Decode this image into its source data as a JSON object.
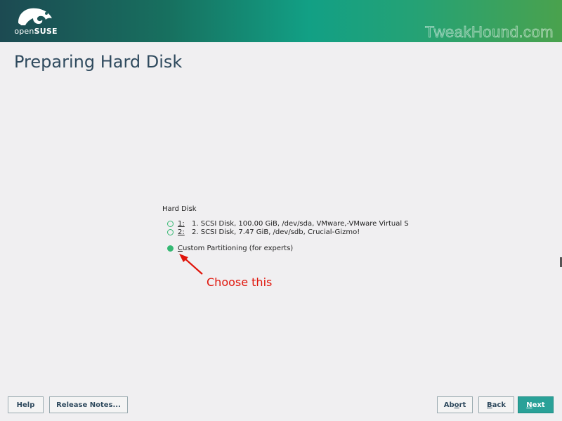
{
  "header": {
    "logo_text_light": "open",
    "logo_text_bold": "SUSE",
    "watermark": "TweakHound.com"
  },
  "page_title": "Preparing Hard Disk",
  "hard_disk": {
    "label": "Hard Disk",
    "options": [
      {
        "key": "1:",
        "text": "1. SCSI Disk, 100.00 GiB, /dev/sda, VMware,-VMware Virtual S",
        "selected": false
      },
      {
        "key": "2:",
        "text": "2. SCSI Disk, 7.47 GiB, /dev/sdb, Crucial-Gizmo!",
        "selected": false
      }
    ],
    "custom": {
      "mnemonic": "C",
      "rest": "ustom Partitioning (for experts)",
      "selected": true
    }
  },
  "annotation": {
    "text": "Choose this",
    "color": "#e0140a"
  },
  "buttons": {
    "help": "Help",
    "release_notes": "Release Notes...",
    "abort": {
      "pre": "Ab",
      "mnemonic": "o",
      "post": "rt"
    },
    "back": {
      "pre": "",
      "mnemonic": "B",
      "post": "ack"
    },
    "next": {
      "pre": "",
      "mnemonic": "N",
      "post": "ext"
    }
  },
  "colors": {
    "accent": "#35b873",
    "primary_button": "#2aa198",
    "title": "#2f4a5e"
  }
}
